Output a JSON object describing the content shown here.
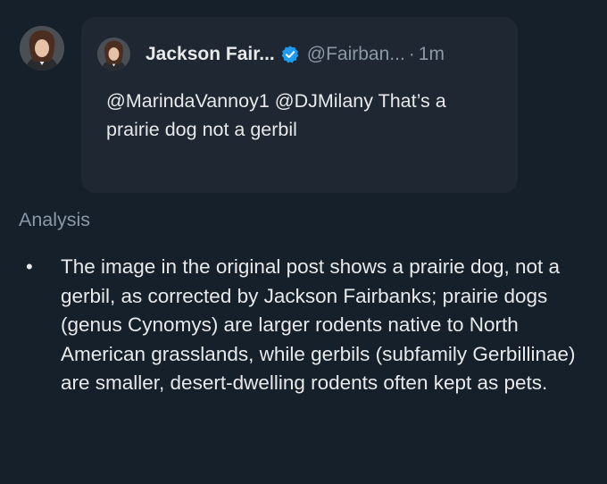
{
  "colors": {
    "background": "#15202b",
    "card": "#1e2732",
    "text_primary": "#e7e9ea",
    "text_secondary": "#8b98a5",
    "verified_badge": "#1d9bf0"
  },
  "reply": {
    "avatar_icon": "user-avatar",
    "quoted_tweet": {
      "author_name": "Jackson Fair...",
      "verified_icon": "verified-badge-icon",
      "handle": "@Fairban...",
      "separator": "·",
      "time": "1m",
      "text": "@MarindaVannoy1 @DJMilany That’s a prairie dog not a gerbil"
    }
  },
  "analysis": {
    "heading": "Analysis",
    "bullets": [
      "The image in the original post shows a prairie dog, not a gerbil, as corrected by Jackson Fairbanks; prairie dogs (genus Cynomys) are larger rodents native to North American grasslands, while gerbils (subfamily Gerbillinae) are smaller, desert-dwelling rodents often kept as pets."
    ]
  }
}
